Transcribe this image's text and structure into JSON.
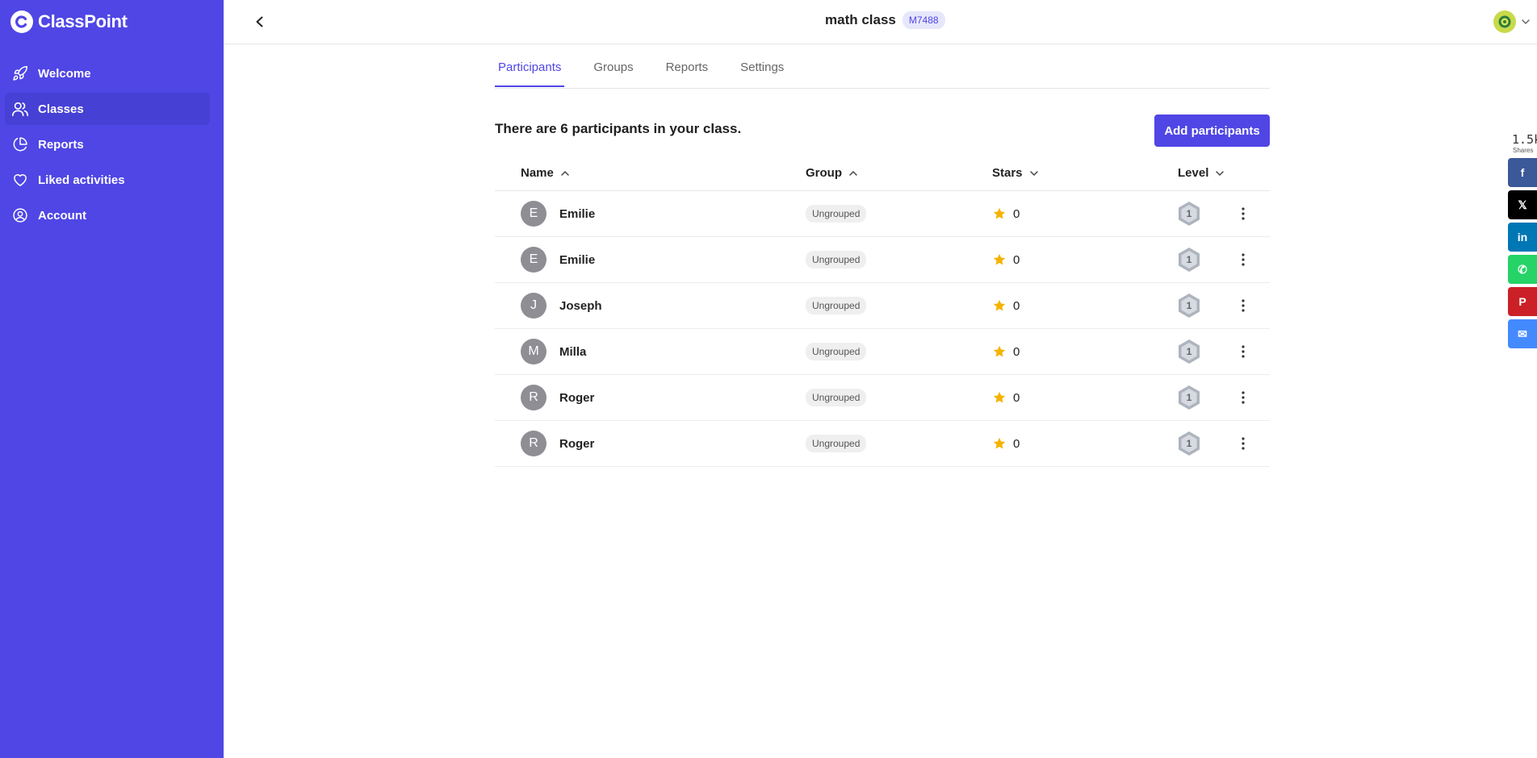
{
  "app": {
    "brand": "ClassPoint"
  },
  "sidebar": {
    "items": [
      {
        "label": "Welcome",
        "icon": "rocket-icon",
        "active": false
      },
      {
        "label": "Classes",
        "icon": "users-icon",
        "active": true
      },
      {
        "label": "Reports",
        "icon": "pie-chart-icon",
        "active": false
      },
      {
        "label": "Liked activities",
        "icon": "heart-icon",
        "active": false
      },
      {
        "label": "Account",
        "icon": "user-circle-icon",
        "active": false
      }
    ]
  },
  "header": {
    "class_name": "math class",
    "class_code": "M7488"
  },
  "tabs": [
    {
      "label": "Participants",
      "active": true
    },
    {
      "label": "Groups",
      "active": false
    },
    {
      "label": "Reports",
      "active": false
    },
    {
      "label": "Settings",
      "active": false
    }
  ],
  "main": {
    "summary": "There are 6 participants in your class.",
    "add_button": "Add participants"
  },
  "table": {
    "columns": [
      {
        "label": "Name",
        "sort": "asc"
      },
      {
        "label": "Group",
        "sort": "asc"
      },
      {
        "label": "Stars",
        "sort": "desc"
      },
      {
        "label": "Level",
        "sort": "desc"
      }
    ],
    "rows": [
      {
        "initial": "E",
        "name": "Emilie",
        "group": "Ungrouped",
        "stars": "0",
        "level": "1"
      },
      {
        "initial": "E",
        "name": "Emilie",
        "group": "Ungrouped",
        "stars": "0",
        "level": "1"
      },
      {
        "initial": "J",
        "name": "Joseph",
        "group": "Ungrouped",
        "stars": "0",
        "level": "1"
      },
      {
        "initial": "M",
        "name": "Milla",
        "group": "Ungrouped",
        "stars": "0",
        "level": "1"
      },
      {
        "initial": "R",
        "name": "Roger",
        "group": "Ungrouped",
        "stars": "0",
        "level": "1"
      },
      {
        "initial": "R",
        "name": "Roger",
        "group": "Ungrouped",
        "stars": "0",
        "level": "1"
      }
    ]
  },
  "share": {
    "count": "1.5k",
    "label": "Shares",
    "buttons": [
      {
        "name": "facebook",
        "glyph": "f",
        "color": "#3b5998"
      },
      {
        "name": "x",
        "glyph": "𝕏",
        "color": "#000000"
      },
      {
        "name": "linkedin",
        "glyph": "in",
        "color": "#0077b5"
      },
      {
        "name": "whatsapp",
        "glyph": "✆",
        "color": "#25d366"
      },
      {
        "name": "pinterest",
        "glyph": "P",
        "color": "#cb2027"
      },
      {
        "name": "messenger",
        "glyph": "✉",
        "color": "#448aff"
      }
    ]
  },
  "colors": {
    "accent": "#4f46e5",
    "star": "#f5b301"
  }
}
